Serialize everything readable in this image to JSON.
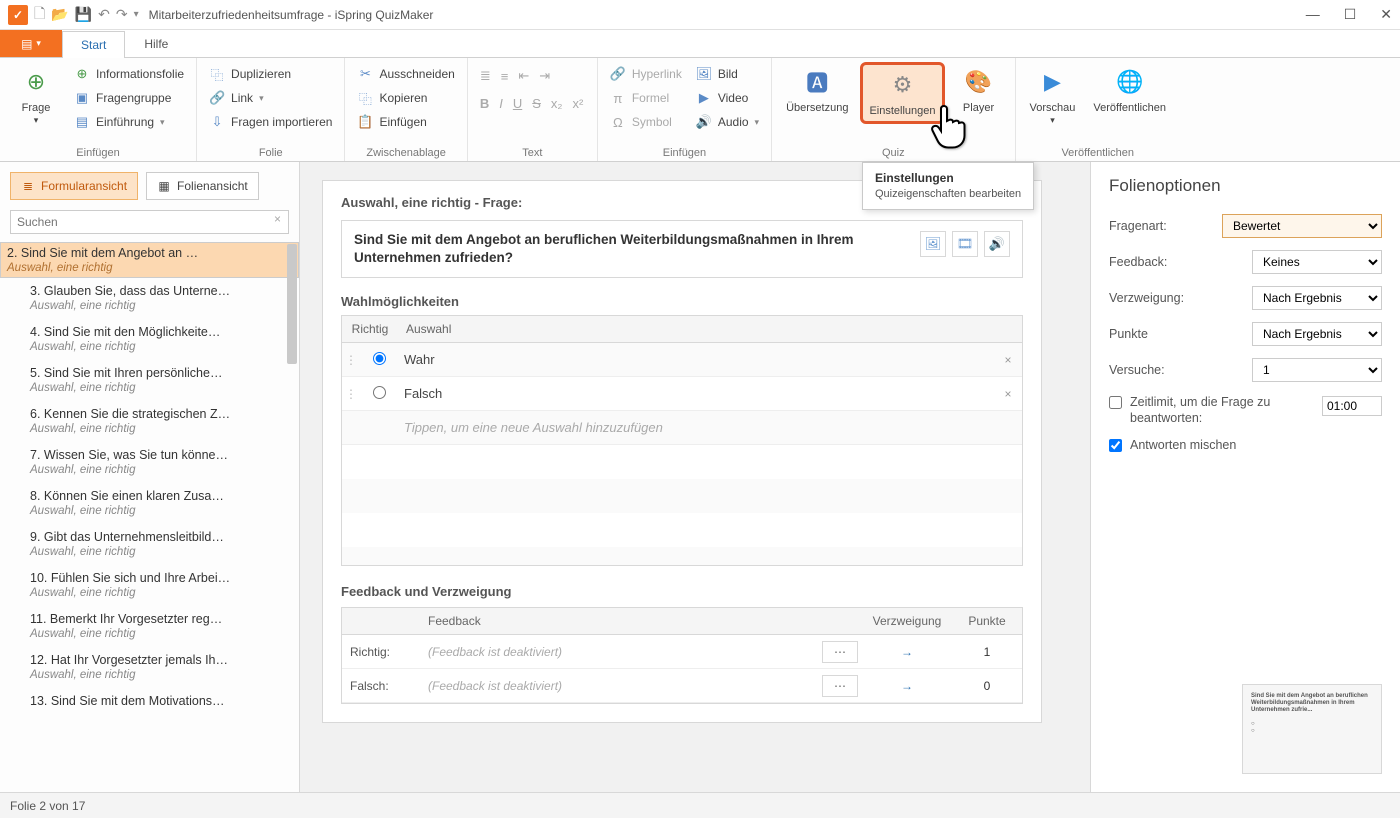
{
  "window": {
    "title": "Mitarbeiterzufriedenheitsumfrage - iSpring QuizMaker"
  },
  "tabs": {
    "start": "Start",
    "help": "Hilfe"
  },
  "ribbon": {
    "insert": {
      "group": "Einfügen",
      "frage": "Frage",
      "info": "Informationsfolie",
      "gruppe": "Fragengruppe",
      "einf": "Einführung"
    },
    "folie": {
      "group": "Folie",
      "dup": "Duplizieren",
      "link": "Link",
      "imp": "Fragen importieren"
    },
    "clip": {
      "group": "Zwischenablage",
      "cut": "Ausschneiden",
      "copy": "Kopieren",
      "paste": "Einfügen"
    },
    "text": {
      "group": "Text"
    },
    "insert2": {
      "group": "Einfügen",
      "hyper": "Hyperlink",
      "formel": "Formel",
      "symbol": "Symbol",
      "bild": "Bild",
      "video": "Video",
      "audio": "Audio"
    },
    "quiz": {
      "group": "Quiz",
      "trans": "Übersetzung",
      "settings": "Einstellungen",
      "player": "Player"
    },
    "publish": {
      "group": "Veröffentlichen",
      "preview": "Vorschau",
      "pub": "Veröffentlichen"
    }
  },
  "tooltip": {
    "title": "Einstellungen",
    "body": "Quizeigenschaften bearbeiten"
  },
  "side": {
    "formview": "Formularansicht",
    "slideview": "Folienansicht",
    "search_ph": "Suchen",
    "items": [
      {
        "n": "2.",
        "t": "Sind Sie mit dem Angebot an …",
        "s": "Auswahl, eine richtig",
        "sel": true
      },
      {
        "n": "3.",
        "t": "Glauben Sie, dass das Unterne…",
        "s": "Auswahl, eine richtig"
      },
      {
        "n": "4.",
        "t": "Sind Sie mit den Möglichkeite…",
        "s": "Auswahl, eine richtig"
      },
      {
        "n": "5.",
        "t": "Sind Sie mit Ihren persönliche…",
        "s": "Auswahl, eine richtig"
      },
      {
        "n": "6.",
        "t": "Kennen Sie die strategischen Z…",
        "s": "Auswahl, eine richtig"
      },
      {
        "n": "7.",
        "t": "Wissen Sie, was Sie tun könne…",
        "s": "Auswahl, eine richtig"
      },
      {
        "n": "8.",
        "t": "Können Sie einen klaren Zusa…",
        "s": "Auswahl, eine richtig"
      },
      {
        "n": "9.",
        "t": "Gibt das Unternehmensleitbild…",
        "s": "Auswahl, eine richtig"
      },
      {
        "n": "10.",
        "t": "Fühlen Sie sich und Ihre Arbei…",
        "s": "Auswahl, eine richtig"
      },
      {
        "n": "11.",
        "t": "Bemerkt Ihr Vorgesetzter reg…",
        "s": "Auswahl, eine richtig"
      },
      {
        "n": "12.",
        "t": "Hat Ihr Vorgesetzter jemals Ih…",
        "s": "Auswahl, eine richtig"
      },
      {
        "n": "13.",
        "t": "Sind Sie mit dem Motivations…",
        "s": ""
      }
    ]
  },
  "editor": {
    "heading": "Auswahl, eine richtig - Frage:",
    "question": "Sind Sie mit dem Angebot an beruflichen Weiterbildungsmaßnahmen in Ihrem Unternehmen zufrieden?",
    "choices_title": "Wahlmöglichkeiten",
    "col_correct": "Richtig",
    "col_choice": "Auswahl",
    "choices": [
      {
        "text": "Wahr",
        "correct": true
      },
      {
        "text": "Falsch",
        "correct": false
      }
    ],
    "add_ph": "Tippen, um eine neue Auswahl hinzuzufügen",
    "fb_title": "Feedback und Verzweigung",
    "fb_col_f": "Feedback",
    "fb_col_b": "Verzweigung",
    "fb_col_p": "Punkte",
    "fb_rows": [
      {
        "label": "Richtig:",
        "text": "(Feedback ist deaktiviert)",
        "points": "1"
      },
      {
        "label": "Falsch:",
        "text": "(Feedback ist deaktiviert)",
        "points": "0"
      }
    ]
  },
  "options": {
    "title": "Folienoptionen",
    "qtype_lbl": "Fragenart:",
    "qtype_val": "Bewertet",
    "feedback_lbl": "Feedback:",
    "feedback_val": "Keines",
    "branch_lbl": "Verzweigung:",
    "branch_val": "Nach Ergebnis",
    "points_lbl": "Punkte",
    "points_val": "Nach Ergebnis",
    "attempts_lbl": "Versuche:",
    "attempts_val": "1",
    "timelimit_lbl": "Zeitlimit, um die Frage zu beantworten:",
    "timelimit_val": "01:00",
    "shuffle_lbl": "Antworten mischen",
    "preview_text": "Sind Sie mit dem Angebot an beruflichen Weiterbildungsmaßnahmen in Ihrem Unternehmen zufrie..."
  },
  "status": "Folie 2 von 17"
}
